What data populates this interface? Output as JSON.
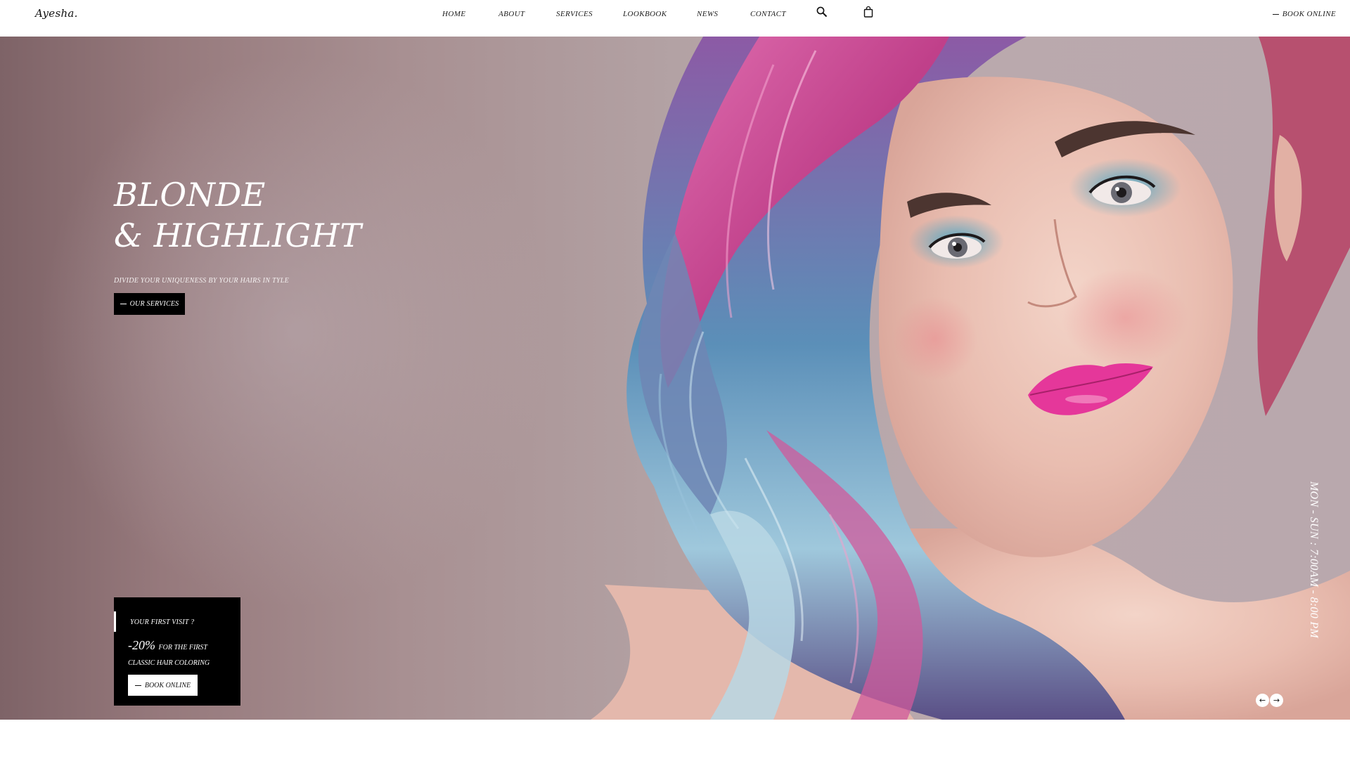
{
  "header": {
    "logo": "Ayesha.",
    "nav": [
      "HOME",
      "ABOUT",
      "SERVICES",
      "LOOKBOOK",
      "NEWS",
      "CONTACT"
    ],
    "search_icon": "search-icon",
    "cart_icon": "shopping-bag-icon",
    "book_online": "BOOK ONLINE"
  },
  "hero": {
    "title_line1": "BLONDE",
    "title_line2": "& HIGHLIGHT",
    "subtitle": "DIVIDE YOUR UNIQUENESS BY YOUR HAIRS IN TYLE",
    "services_button": "OUR SERVICES",
    "hours": "MON - SUN : 7:00AM - 8:00 PM",
    "prev_icon": "arrow-left-icon",
    "next_icon": "arrow-right-icon",
    "prev_glyph": "←",
    "next_glyph": "→"
  },
  "promo": {
    "question": "YOUR FIRST VISIT ?",
    "discount": "-20%",
    "line1": "FOR THE FIRST",
    "line2": "CLASSIC HAIR COLORING",
    "button": "BOOK ONLINE"
  },
  "colors": {
    "accent": "#000000",
    "text_light": "#ffffff",
    "hair_pink": "#d9468f",
    "hair_blue": "#6aa8c9",
    "lips": "#e5379a"
  }
}
